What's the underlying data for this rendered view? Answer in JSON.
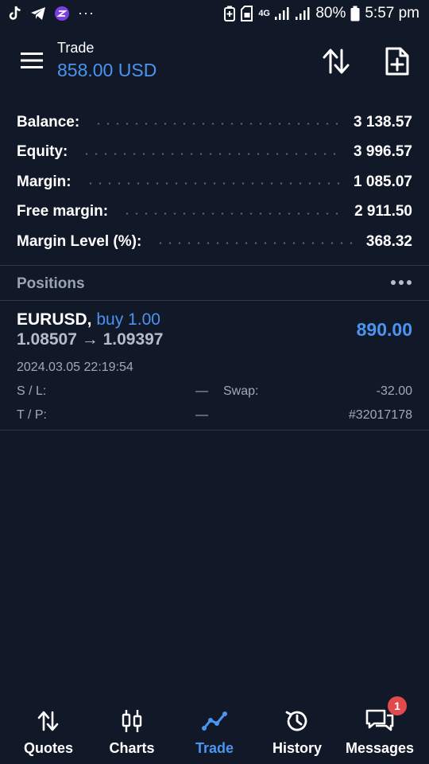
{
  "statusbar": {
    "network": "4G",
    "battery": "80%",
    "time": "5:57 pm",
    "more": "···"
  },
  "toolbar": {
    "title": "Trade",
    "subtitle": "858.00 USD"
  },
  "summary": [
    {
      "label": "Balance:",
      "value": "3 138.57"
    },
    {
      "label": "Equity:",
      "value": "3 996.57"
    },
    {
      "label": "Margin:",
      "value": "1 085.07"
    },
    {
      "label": "Free margin:",
      "value": "2 911.50"
    },
    {
      "label": "Margin Level (%):",
      "value": "368.32"
    }
  ],
  "positions": {
    "title": "Positions",
    "items": [
      {
        "symbol": "EURUSD,",
        "direction": "buy 1.00",
        "prices": "1.08507 → 1.09397",
        "profit": "890.00",
        "time": "2024.03.05 22:19:54",
        "sl_label": "S / L:",
        "sl_value": "—",
        "swap_label": "Swap:",
        "swap_value": "-32.00",
        "tp_label": "T / P:",
        "tp_value": "—",
        "ticket": "#32017178"
      }
    ]
  },
  "nav": [
    {
      "label": "Quotes",
      "icon": "quotes-icon"
    },
    {
      "label": "Charts",
      "icon": "charts-icon"
    },
    {
      "label": "Trade",
      "icon": "trade-icon",
      "active": true
    },
    {
      "label": "History",
      "icon": "history-icon"
    },
    {
      "label": "Messages",
      "icon": "messages-icon",
      "badge": "1"
    }
  ],
  "colors": {
    "background": "#111827",
    "accent": "#4b94f0",
    "badge": "#e24b4b"
  }
}
